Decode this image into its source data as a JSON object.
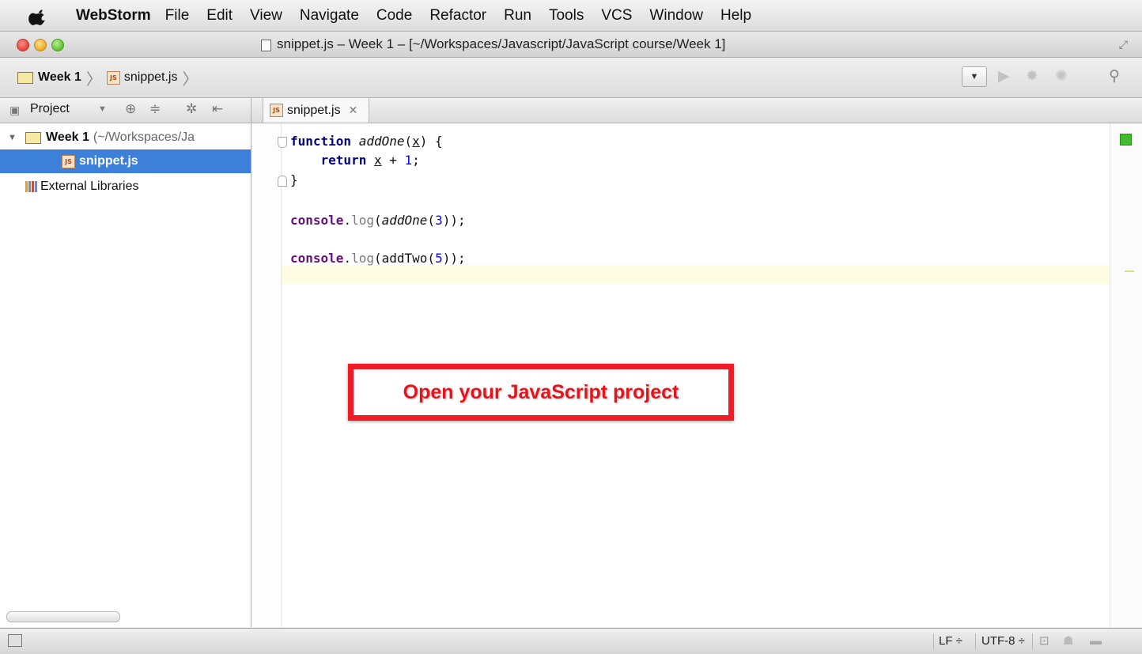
{
  "menubar": {
    "app_name": "WebStorm",
    "items": [
      "File",
      "Edit",
      "View",
      "Navigate",
      "Code",
      "Refactor",
      "Run",
      "Tools",
      "VCS",
      "Window",
      "Help"
    ]
  },
  "window": {
    "title": "snippet.js – Week 1 – [~/Workspaces/Javascript/JavaScript course/Week 1]"
  },
  "navbar": {
    "breadcrumb_folder": "Week 1",
    "breadcrumb_file": "snippet.js"
  },
  "project_panel": {
    "view_label": "Project",
    "tree": [
      {
        "label": "Week 1",
        "detail": "(~/Workspaces/Ja",
        "type": "folder"
      },
      {
        "label": "snippet.js",
        "type": "js-file",
        "selected": true
      },
      {
        "label": "External Libraries",
        "type": "libraries"
      }
    ]
  },
  "editor": {
    "tab_label": "snippet.js",
    "code": {
      "l1_kw": "function",
      "l1_fn": "addOne",
      "l1_param": "x",
      "l2_kw": "return",
      "l2_param": "x",
      "l2_rest": " + ",
      "l2_num": "1",
      "l4_obj": "console",
      "l4_prop": "log",
      "l4_fn": "addOne",
      "l4_num": "3",
      "l6_obj": "console",
      "l6_prop": "log",
      "l6_fn": "addTwo",
      "l6_num": "5"
    }
  },
  "callout": {
    "text": "Open your JavaScript project"
  },
  "statusbar": {
    "line_separator": "LF ÷",
    "encoding": "UTF-8 ÷"
  },
  "colors": {
    "selection": "#3d80d9",
    "callout_red": "#ef1c25",
    "keyword": "#000080",
    "number": "#0000ff"
  }
}
